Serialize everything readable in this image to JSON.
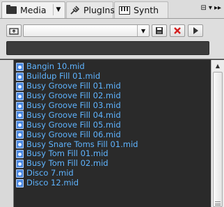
{
  "tabs": [
    {
      "label": "Media",
      "icon": "folder-icon"
    },
    {
      "label": "PlugIns",
      "icon": "plugin-icon"
    },
    {
      "label": "Synth",
      "icon": "synth-icon"
    }
  ],
  "toolbar": {
    "combo_value": "",
    "path_value": ""
  },
  "files": [
    "Bangin 10.mid",
    "Buildup Fill 01.mid",
    "Busy Groove Fill 01.mid",
    "Busy Groove Fill 02.mid",
    "Busy Groove Fill 03.mid",
    "Busy Groove Fill 04.mid",
    "Busy Groove Fill 05.mid",
    "Busy Groove Fill 06.mid",
    "Busy Snare Toms Fill 01.mid",
    "Busy Tom Fill 01.mid",
    "Busy Tom Fill 02.mid",
    "Disco 7.mid",
    "Disco 12.mid"
  ],
  "colors": {
    "file_text": "#5fb4ff",
    "list_background": "#2a2a2a",
    "delete_icon": "#d42020"
  }
}
